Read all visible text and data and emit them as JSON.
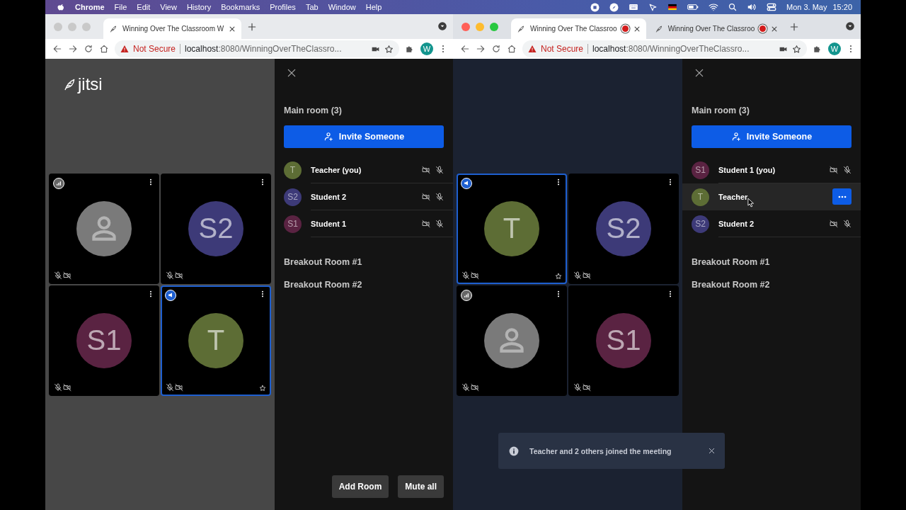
{
  "menu_bar": {
    "app": "Chrome",
    "items": [
      "File",
      "Edit",
      "View",
      "History",
      "Bookmarks",
      "Profiles",
      "Tab",
      "Window",
      "Help"
    ],
    "date": "Mon 3. May",
    "time": "15:20"
  },
  "windows": [
    {
      "active": false,
      "tabs": [
        {
          "title": "Winning Over The Classroom W",
          "selected": true,
          "recording": false
        }
      ],
      "address": {
        "warning": "Not Secure",
        "host": "localhost",
        "path": ":8080/WinningOverTheClassro..."
      },
      "profile": "W",
      "logo": "jitsi",
      "color": "#474747",
      "tiles": [
        {
          "kind": "placeholder",
          "color": "#7a7a7a",
          "highlighted": false,
          "connection_indicator": true
        },
        {
          "kind": "initials",
          "initials": "S2",
          "color": "#3d3a78",
          "highlighted": false
        },
        {
          "kind": "initials",
          "initials": "S1",
          "color": "#5a2342",
          "highlighted": false
        },
        {
          "kind": "initials",
          "initials": "T",
          "color": "#5d6d35",
          "highlighted": true,
          "moderator": true
        }
      ],
      "panel": {
        "title": "Main room (3)",
        "invite": "Invite Someone",
        "participants": [
          {
            "initials": "T",
            "name": "Teacher (you)",
            "color": "#5d6d35",
            "hovered": false
          },
          {
            "initials": "S2",
            "name": "Student 2",
            "color": "#3d3a78",
            "hovered": false
          },
          {
            "initials": "S1",
            "name": "Student 1",
            "color": "#5a2342",
            "hovered": false
          }
        ],
        "rooms": [
          "Breakout Room #1",
          "Breakout Room #2"
        ],
        "buttons": [
          "Add Room",
          "Mute all"
        ]
      }
    },
    {
      "active": true,
      "tabs": [
        {
          "title": "Winning Over The Classroo",
          "selected": true,
          "recording": true
        },
        {
          "title": "Winning Over The Classroo",
          "selected": false,
          "recording": true
        }
      ],
      "address": {
        "warning": "Not Secure",
        "host": "localhost",
        "path": ":8080/WinningOverTheClassro..."
      },
      "profile": "W",
      "color": "#1b2231",
      "tiles": [
        {
          "kind": "initials",
          "initials": "T",
          "color": "#5d6d35",
          "highlighted": true,
          "moderator": true
        },
        {
          "kind": "initials",
          "initials": "S2",
          "color": "#3d3a78",
          "highlighted": false
        },
        {
          "kind": "placeholder",
          "color": "#7a7a7a",
          "highlighted": false,
          "connection_indicator": true
        },
        {
          "kind": "initials",
          "initials": "S1",
          "color": "#5a2342",
          "highlighted": false
        }
      ],
      "panel": {
        "title": "Main room (3)",
        "invite": "Invite Someone",
        "participants": [
          {
            "initials": "S1",
            "name": "Student 1 (you)",
            "color": "#5a2342",
            "hovered": false
          },
          {
            "initials": "T",
            "name": "Teacher",
            "color": "#5d6d35",
            "hovered": true
          },
          {
            "initials": "S2",
            "name": "Student 2",
            "color": "#3d3a78",
            "hovered": false
          }
        ],
        "rooms": [
          "Breakout Room #1",
          "Breakout Room #2"
        ]
      },
      "toast": {
        "text": "Teacher and 2 others joined the meeting"
      }
    }
  ]
}
